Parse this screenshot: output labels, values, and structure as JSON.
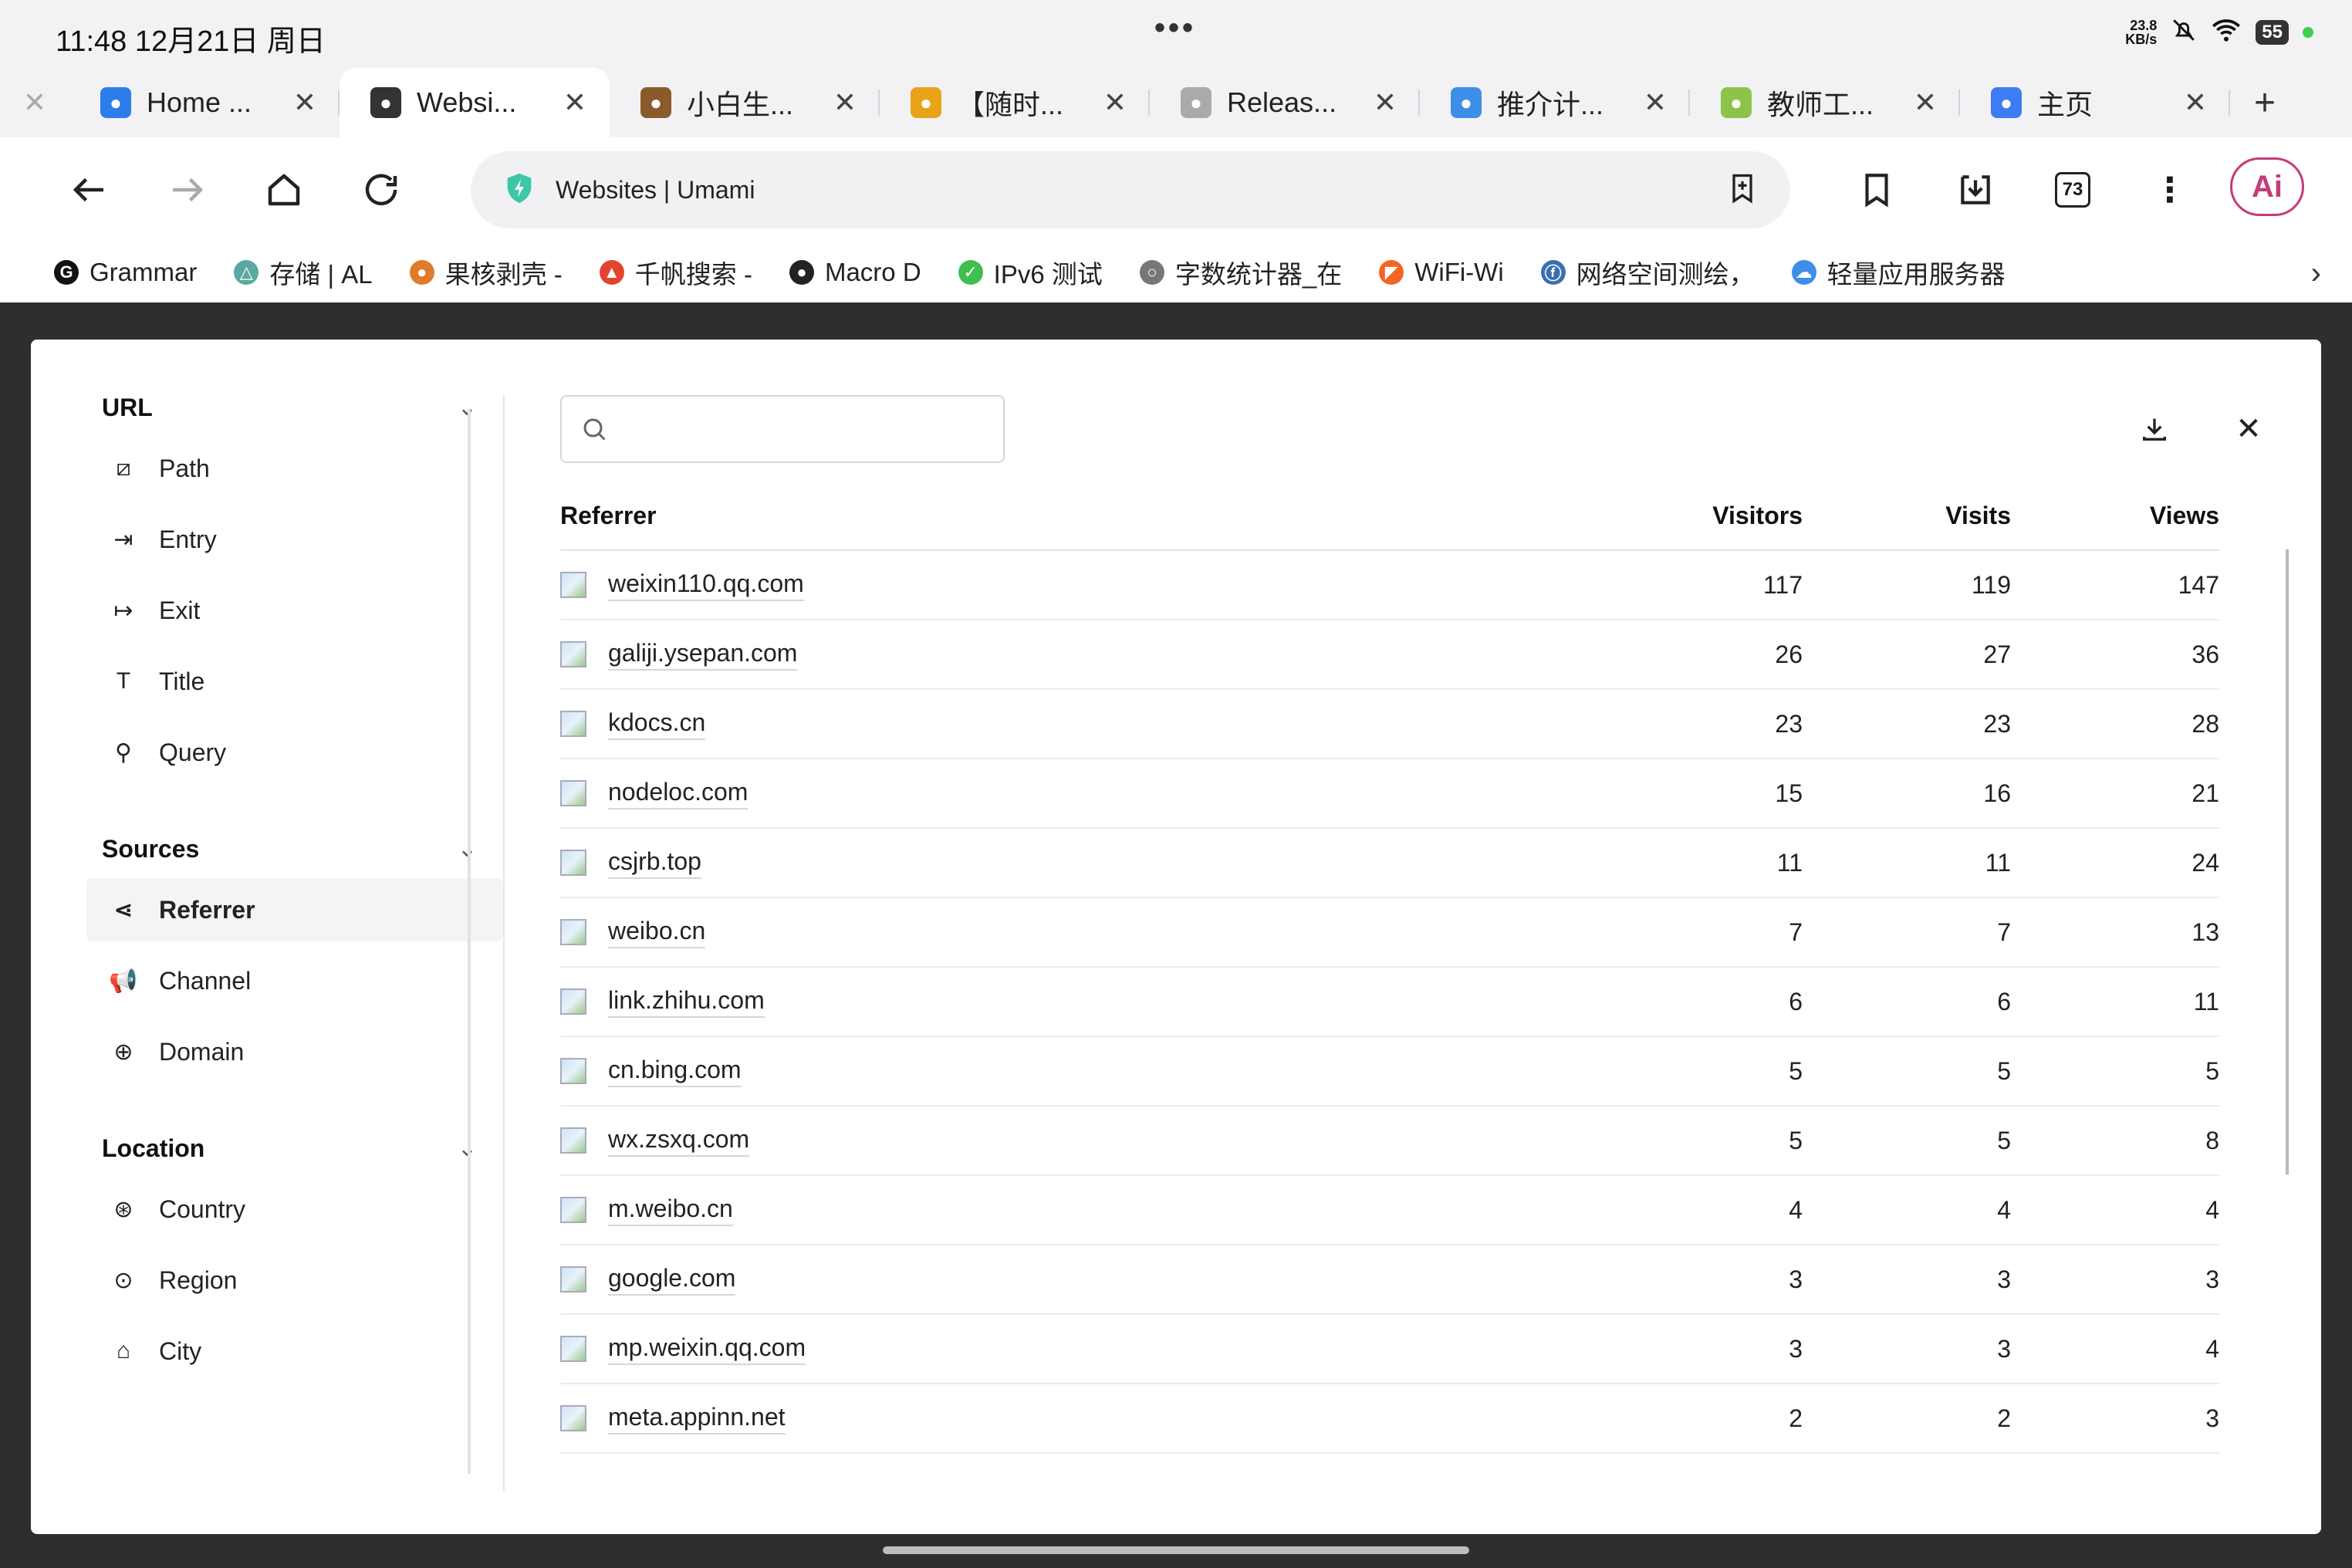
{
  "status_bar": {
    "time": "11:48  12月21日 周日",
    "network_speed_value": "23.8",
    "network_speed_unit": "KB/s",
    "battery": "55"
  },
  "tabs": [
    {
      "label": "Home ...",
      "favicon": "bing-icon",
      "color": "#2b7de9"
    },
    {
      "label": "Websi...",
      "favicon": "cloud-icon",
      "color": "#333333",
      "active": true
    },
    {
      "label": "小白生...",
      "favicon": "cat-icon",
      "color": "#8a5a2b"
    },
    {
      "label": "【随时...",
      "favicon": "sun-icon",
      "color": "#e8a317"
    },
    {
      "label": "Releas...",
      "favicon": "github-icon",
      "color": "#aaaaaa"
    },
    {
      "label": "推介计...",
      "favicon": "cloud-blue-icon",
      "color": "#3d8ee8"
    },
    {
      "label": "教师工...",
      "favicon": "nl-icon",
      "color": "#8cc34a"
    },
    {
      "label": "主页",
      "favicon": "home-app-icon",
      "color": "#3d7cf2"
    }
  ],
  "address_bar": {
    "url_text": "Websites | Umami",
    "tab_count": "73",
    "ai_label": "Ai"
  },
  "bookmarks": [
    {
      "label": "Grammar",
      "color": "#111111",
      "glyph": "G"
    },
    {
      "label": "存储 | AL",
      "color": "#5aa9a0",
      "glyph": "△"
    },
    {
      "label": "果核剥壳 -",
      "color": "#e07b2a",
      "glyph": "●"
    },
    {
      "label": "千帆搜索 -",
      "color": "#e2452f",
      "glyph": "▲"
    },
    {
      "label": "Macro D",
      "color": "#222222",
      "glyph": "●"
    },
    {
      "label": "IPv6 测试",
      "color": "#3fbf4f",
      "glyph": "✓"
    },
    {
      "label": "字数统计器_在",
      "color": "#777777",
      "glyph": "○"
    },
    {
      "label": "WiFi-Wi",
      "color": "#f26522",
      "glyph": "◤"
    },
    {
      "label": "网络空间测绘，",
      "color": "#3a6fb0",
      "glyph": "ⓕ"
    },
    {
      "label": "轻量应用服务器",
      "color": "#3d8ee8",
      "glyph": "☁"
    }
  ],
  "sidebar": {
    "sections": [
      {
        "title": "URL",
        "items": [
          {
            "label": "Path",
            "icon": "path-icon",
            "glyph": "⧄"
          },
          {
            "label": "Entry",
            "icon": "entry-icon",
            "glyph": "⇥"
          },
          {
            "label": "Exit",
            "icon": "exit-icon",
            "glyph": "↦"
          },
          {
            "label": "Title",
            "icon": "title-icon",
            "glyph": "T"
          },
          {
            "label": "Query",
            "icon": "query-icon",
            "glyph": "⚲"
          }
        ]
      },
      {
        "title": "Sources",
        "items": [
          {
            "label": "Referrer",
            "icon": "share-icon",
            "glyph": "⋖",
            "active": true
          },
          {
            "label": "Channel",
            "icon": "megaphone-icon",
            "glyph": "📢"
          },
          {
            "label": "Domain",
            "icon": "globe-icon",
            "glyph": "⊕"
          }
        ]
      },
      {
        "title": "Location",
        "items": [
          {
            "label": "Country",
            "icon": "earth-icon",
            "glyph": "⊛"
          },
          {
            "label": "Region",
            "icon": "map-pin-icon",
            "glyph": "⊙"
          },
          {
            "label": "City",
            "icon": "landmark-icon",
            "glyph": "⌂"
          }
        ]
      }
    ]
  },
  "search": {
    "placeholder": ""
  },
  "table": {
    "headers": {
      "referrer": "Referrer",
      "visitors": "Visitors",
      "visits": "Visits",
      "views": "Views"
    },
    "rows": [
      {
        "referrer": "weixin110.qq.com",
        "visitors": "117",
        "visits": "119",
        "views": "147"
      },
      {
        "referrer": "galiji.ysepan.com",
        "visitors": "26",
        "visits": "27",
        "views": "36"
      },
      {
        "referrer": "kdocs.cn",
        "visitors": "23",
        "visits": "23",
        "views": "28"
      },
      {
        "referrer": "nodeloc.com",
        "visitors": "15",
        "visits": "16",
        "views": "21"
      },
      {
        "referrer": "csjrb.top",
        "visitors": "11",
        "visits": "11",
        "views": "24"
      },
      {
        "referrer": "weibo.cn",
        "visitors": "7",
        "visits": "7",
        "views": "13"
      },
      {
        "referrer": "link.zhihu.com",
        "visitors": "6",
        "visits": "6",
        "views": "11"
      },
      {
        "referrer": "cn.bing.com",
        "visitors": "5",
        "visits": "5",
        "views": "5"
      },
      {
        "referrer": "wx.zsxq.com",
        "visitors": "5",
        "visits": "5",
        "views": "8"
      },
      {
        "referrer": "m.weibo.cn",
        "visitors": "4",
        "visits": "4",
        "views": "4"
      },
      {
        "referrer": "google.com",
        "visitors": "3",
        "visits": "3",
        "views": "3"
      },
      {
        "referrer": "mp.weixin.qq.com",
        "visitors": "3",
        "visits": "3",
        "views": "4"
      },
      {
        "referrer": "meta.appinn.net",
        "visitors": "2",
        "visits": "2",
        "views": "3"
      }
    ]
  }
}
